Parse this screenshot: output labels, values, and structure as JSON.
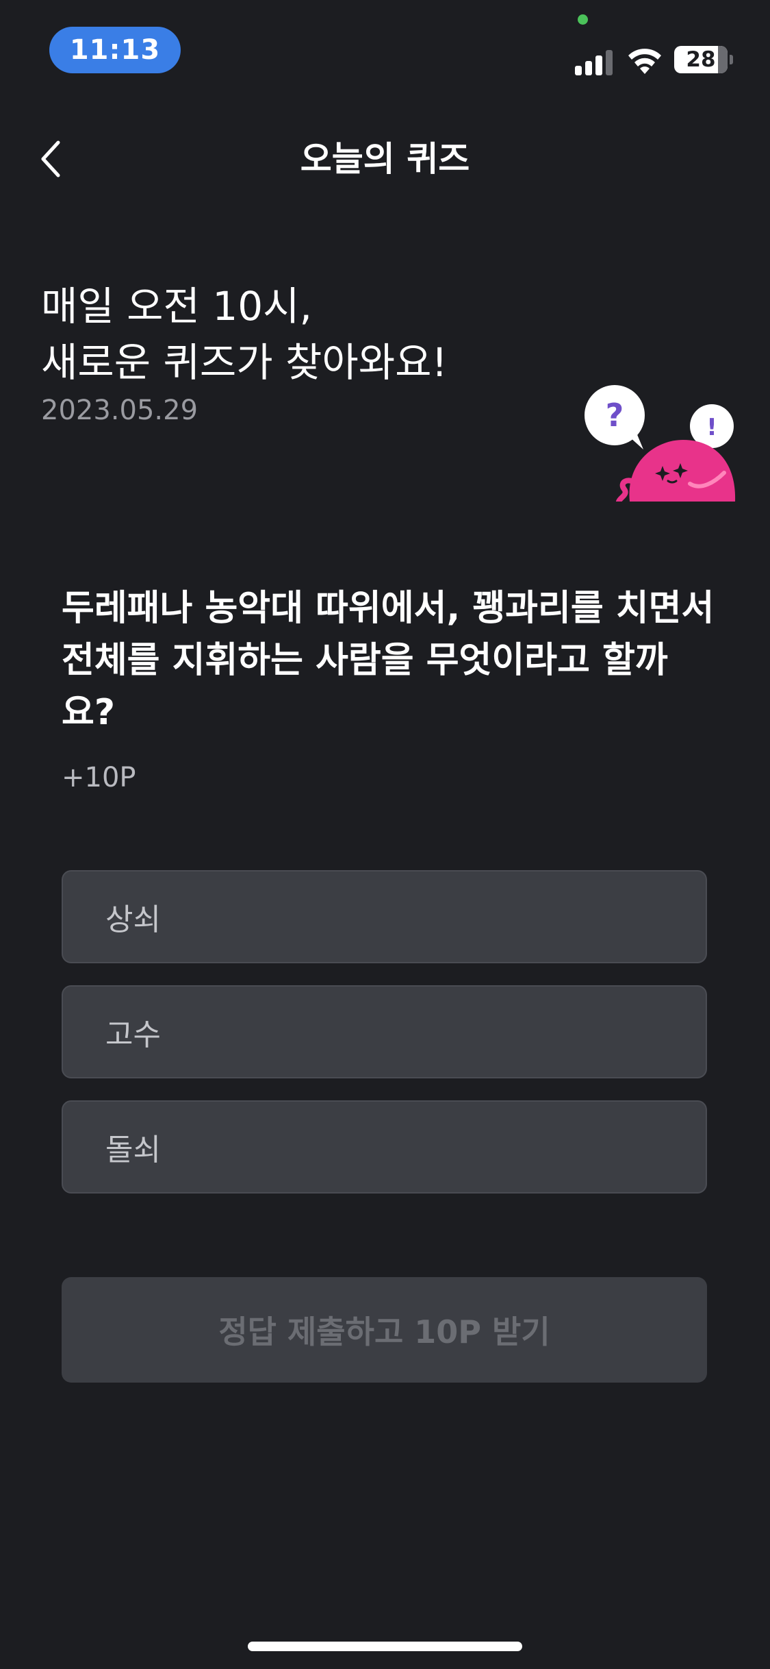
{
  "status_bar": {
    "time": "11:13",
    "battery_level": "28",
    "colors": {
      "time_pill": "#3a7ee6",
      "privacy_dot": "#4bc25a"
    },
    "icons": [
      "cellular-signal-icon",
      "wifi-icon",
      "battery-icon"
    ]
  },
  "nav": {
    "back_icon": "chevron-left-icon",
    "title": "오늘의 퀴즈"
  },
  "intro": {
    "line1": "매일 오전 10시,",
    "line2": "새로운 퀴즈가 찾아와요!",
    "date": "2023.05.29",
    "mascot": {
      "question_mark": "?",
      "exclamation_mark": "!"
    }
  },
  "quiz": {
    "question": "두레패나 농악대 따위에서, 꽹과리를 치면서 전체를 지휘하는 사람을 무엇이라고 할까요?",
    "points": "+10P",
    "options": [
      {
        "label": "상쇠"
      },
      {
        "label": "고수"
      },
      {
        "label": "돌쇠"
      }
    ],
    "submit_label": "정답 제출하고 10P 받기",
    "submit_enabled": false
  },
  "theme": {
    "background": "#1c1d21",
    "option_background": "#3c3e44",
    "mascot_pink": "#e8338a",
    "accent_purple": "#6f4fc9"
  }
}
